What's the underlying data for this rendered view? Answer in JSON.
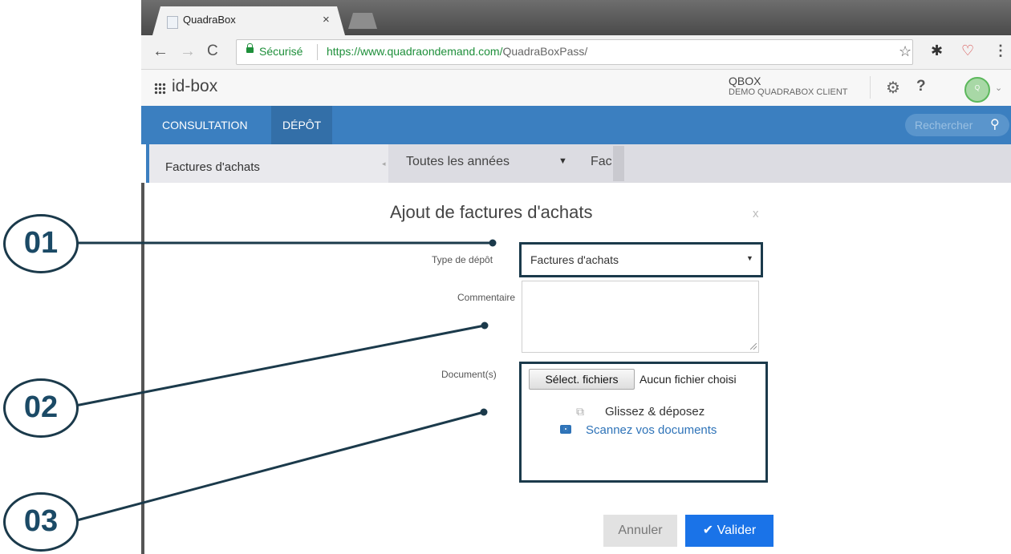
{
  "browser": {
    "tab_title": "QuadraBox",
    "tab_close": "×",
    "secure_label": "Sécurisé",
    "url_origin": "https://www.quadraondemand.com/",
    "url_path": "QuadraBoxPass/"
  },
  "app": {
    "brand": "id-box",
    "qbox_name": "QBOX",
    "qbox_client": "DEMO QUADRABOX CLIENT",
    "help": "?",
    "avatar_letter": "Q"
  },
  "nav": {
    "tabs": [
      {
        "label": "CONSULTATION",
        "active": false
      },
      {
        "label": "DÉPÔT",
        "active": true
      }
    ],
    "search_placeholder": "Rechercher"
  },
  "left_panel": {
    "label": "Factures d'achats"
  },
  "filters": {
    "year": "Toutes les années",
    "second": "Fac"
  },
  "dialog": {
    "title": "Ajout de factures d'achats",
    "close": "x",
    "type_label": "Type de dépôt",
    "type_value": "Factures d'achats",
    "comment_label": "Commentaire",
    "documents_label": "Document(s)",
    "file_button": "Sélect. fichiers",
    "no_file": "Aucun fichier choisi",
    "drop_text": "Glissez & déposez",
    "scan_link": "Scannez vos documents",
    "cancel": "Annuler",
    "ok": "Valider"
  },
  "annotations": [
    "01",
    "02",
    "03"
  ],
  "colors": {
    "accent": "#3b7fc0",
    "primary_button": "#1a73e8",
    "annotation": "#1b3a4b"
  }
}
